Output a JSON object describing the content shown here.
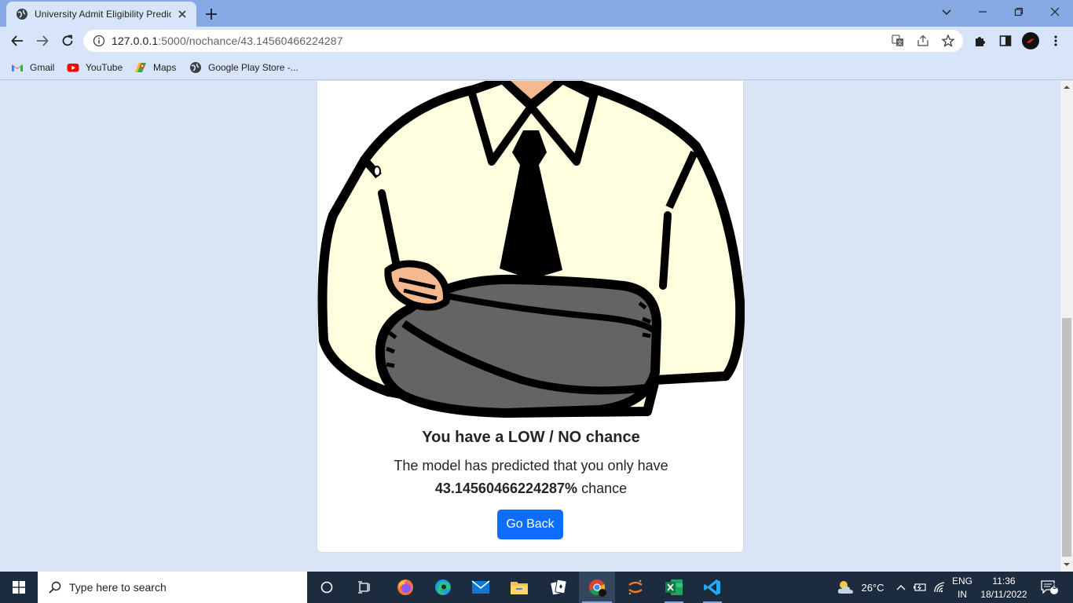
{
  "browser": {
    "tab": {
      "title": "University Admit Eligibility Predic"
    },
    "url_host": "127.0.0.1",
    "url_path": ":5000/nochance/43.14560466224287",
    "bookmarks": [
      {
        "label": "Gmail",
        "icon": "gmail-icon"
      },
      {
        "label": "YouTube",
        "icon": "youtube-icon"
      },
      {
        "label": "Maps",
        "icon": "maps-icon"
      },
      {
        "label": "Google Play Store -...",
        "icon": "globe-icon"
      }
    ]
  },
  "page": {
    "heading": "You have a LOW / NO chance",
    "message_prefix": "The model has predicted that you only have",
    "chance_value": "43.14560466224287%",
    "message_suffix": "chance",
    "button_label": "Go Back"
  },
  "taskbar": {
    "search_placeholder": "Type here to search",
    "weather": "26°C",
    "language": "ENG",
    "region": "IN",
    "time": "11:36",
    "date": "18/11/2022",
    "notifications": "3"
  },
  "colors": {
    "primary": "#0d6efd",
    "tabstrip": "#87a9e3",
    "toolbar": "#d7e4fa",
    "page_bg": "#dae4f7",
    "taskbar": "#1c2b3d"
  }
}
